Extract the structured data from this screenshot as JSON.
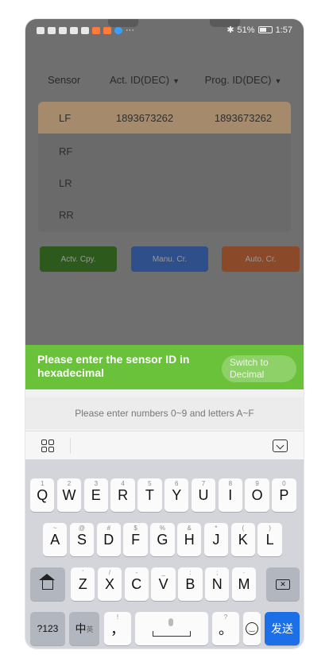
{
  "status_bar": {
    "battery": "51%",
    "time": "1:57",
    "more": "···"
  },
  "header": {
    "col_sensor": "Sensor",
    "col_act": "Act. ID(DEC)",
    "col_prog": "Prog. ID(DEC)",
    "caret": "▼"
  },
  "rows": [
    {
      "pos": "LF",
      "act": "1893673262",
      "prog": "1893673262"
    },
    {
      "pos": "RF",
      "act": "",
      "prog": ""
    },
    {
      "pos": "LR",
      "act": "",
      "prog": ""
    },
    {
      "pos": "RR",
      "act": "",
      "prog": ""
    }
  ],
  "buttons": {
    "copy": "Actv. Cpy.",
    "manual": "Manu. Cr.",
    "auto": "Auto. Cr."
  },
  "banner": {
    "text": "Please enter the sensor ID in hexadecimal",
    "switch": "Switch to Decimal",
    "color": "#6ac23a"
  },
  "hint": "Please enter numbers 0~9 and letters A~F",
  "keyboard": {
    "row1": [
      {
        "k": "Q",
        "s": "1"
      },
      {
        "k": "W",
        "s": "2"
      },
      {
        "k": "E",
        "s": "3"
      },
      {
        "k": "R",
        "s": "4"
      },
      {
        "k": "T",
        "s": "5"
      },
      {
        "k": "Y",
        "s": "6"
      },
      {
        "k": "U",
        "s": "7"
      },
      {
        "k": "I",
        "s": "8"
      },
      {
        "k": "O",
        "s": "9"
      },
      {
        "k": "P",
        "s": "0"
      }
    ],
    "row2": [
      {
        "k": "A",
        "s": "~"
      },
      {
        "k": "S",
        "s": "@"
      },
      {
        "k": "D",
        "s": "#"
      },
      {
        "k": "F",
        "s": "$"
      },
      {
        "k": "G",
        "s": "%"
      },
      {
        "k": "H",
        "s": "&"
      },
      {
        "k": "J",
        "s": "*"
      },
      {
        "k": "K",
        "s": "("
      },
      {
        "k": "L",
        "s": ")"
      }
    ],
    "row3": [
      {
        "k": "Z",
        "s": "'"
      },
      {
        "k": "X",
        "s": "/"
      },
      {
        "k": "C",
        "s": "-"
      },
      {
        "k": "V",
        "s": "_"
      },
      {
        "k": "B",
        "s": ":"
      },
      {
        "k": "N",
        "s": ";"
      },
      {
        "k": "M",
        "s": "·"
      }
    ],
    "num_label": "?123",
    "lang_label": "中",
    "lang_sub": "英",
    "comma": "，",
    "comma_sub": "!",
    "period": "。",
    "period_sub": "?",
    "send": "发送",
    "send_color": "#1d6fe8"
  }
}
